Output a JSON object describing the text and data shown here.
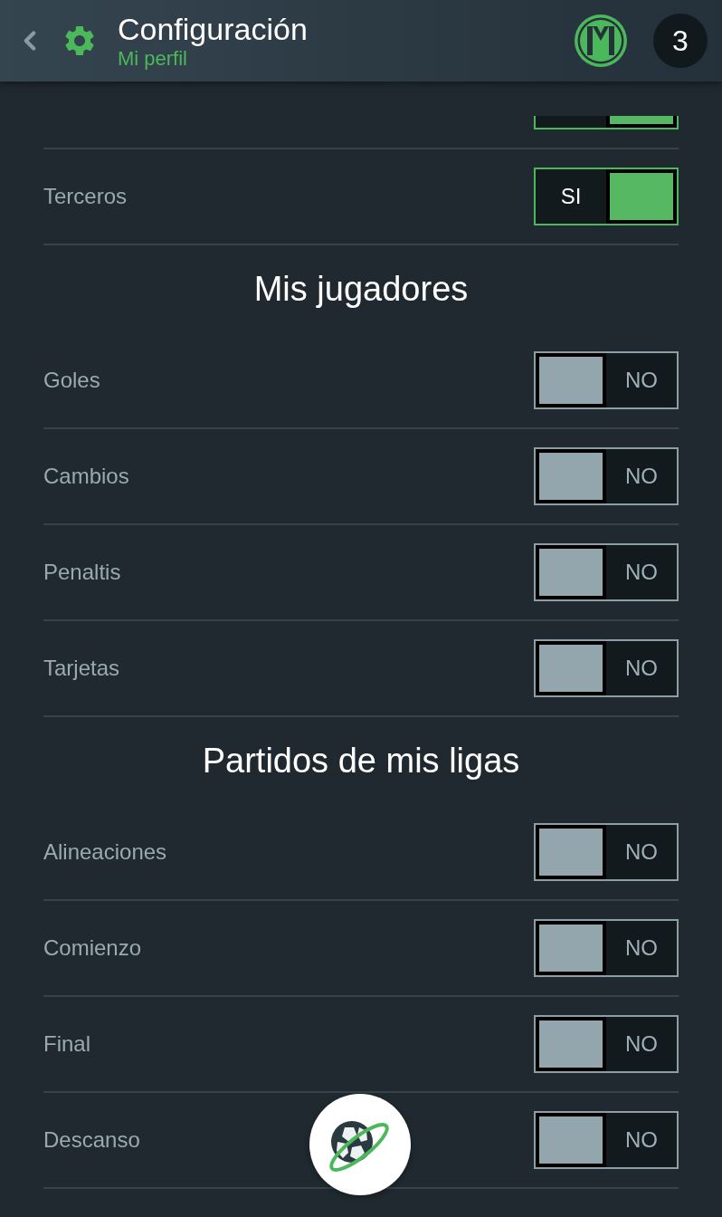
{
  "header": {
    "title": "Configuración",
    "subtitle": "Mi perfil",
    "badge": "3"
  },
  "sections": [
    {
      "items": [
        {
          "kind": "partial",
          "on": true
        },
        {
          "kind": "toggle",
          "label": "Terceros",
          "on": true,
          "value": "SI"
        }
      ]
    },
    {
      "heading": "Mis jugadores",
      "items": [
        {
          "kind": "toggle",
          "label": "Goles",
          "on": false,
          "value": "NO"
        },
        {
          "kind": "toggle",
          "label": "Cambios",
          "on": false,
          "value": "NO"
        },
        {
          "kind": "toggle",
          "label": "Penaltis",
          "on": false,
          "value": "NO"
        },
        {
          "kind": "toggle",
          "label": "Tarjetas",
          "on": false,
          "value": "NO"
        }
      ]
    },
    {
      "heading": "Partidos de mis ligas",
      "items": [
        {
          "kind": "toggle",
          "label": "Alineaciones",
          "on": false,
          "value": "NO"
        },
        {
          "kind": "toggle",
          "label": "Comienzo",
          "on": false,
          "value": "NO"
        },
        {
          "kind": "toggle",
          "label": "Final",
          "on": false,
          "value": "NO"
        },
        {
          "kind": "toggle",
          "label": "Descanso",
          "on": false,
          "value": "NO"
        }
      ]
    }
  ]
}
